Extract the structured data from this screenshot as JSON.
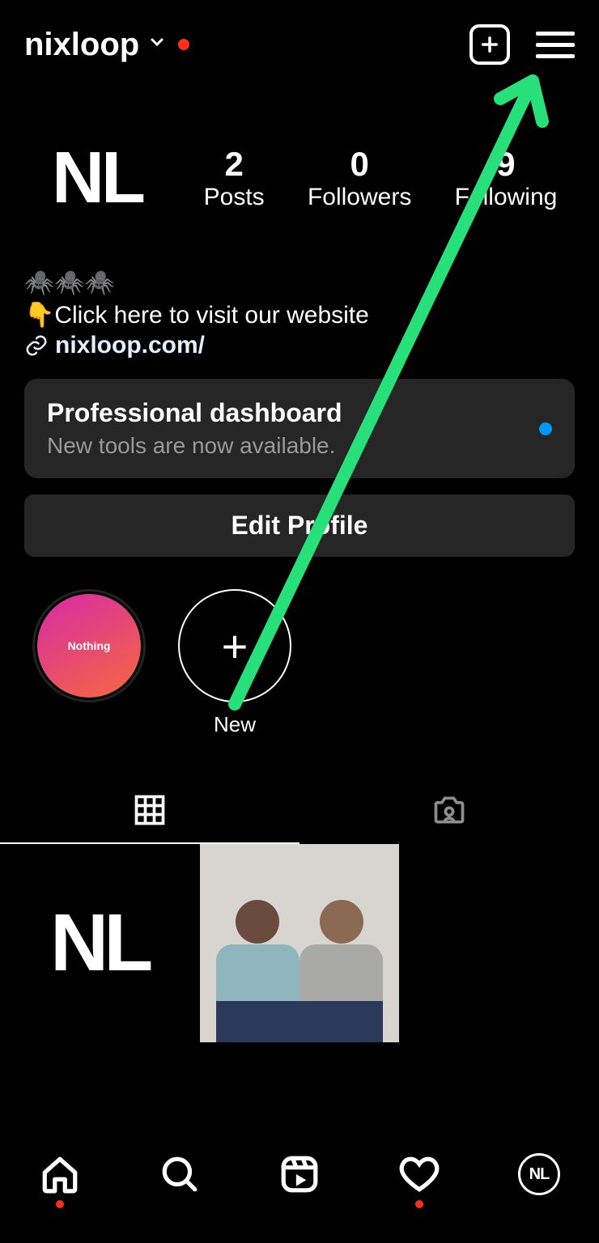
{
  "header": {
    "username": "nixloop"
  },
  "profile": {
    "avatar_text": "NL",
    "stats": {
      "posts": {
        "count": "2",
        "label": "Posts"
      },
      "followers": {
        "count": "0",
        "label": "Followers"
      },
      "following": {
        "count": "9",
        "label": "Following"
      }
    }
  },
  "bio": {
    "line1": "🕷️🕷️🕷️",
    "line2": "👇Click here to visit our website",
    "link": "nixloop.com/"
  },
  "dashboard": {
    "title": "Professional dashboard",
    "subtitle": "New tools are now available."
  },
  "buttons": {
    "edit_profile": "Edit Profile"
  },
  "highlights": {
    "story1_label": "Nothing",
    "new_label": "New"
  },
  "nav_avatar": "NL"
}
